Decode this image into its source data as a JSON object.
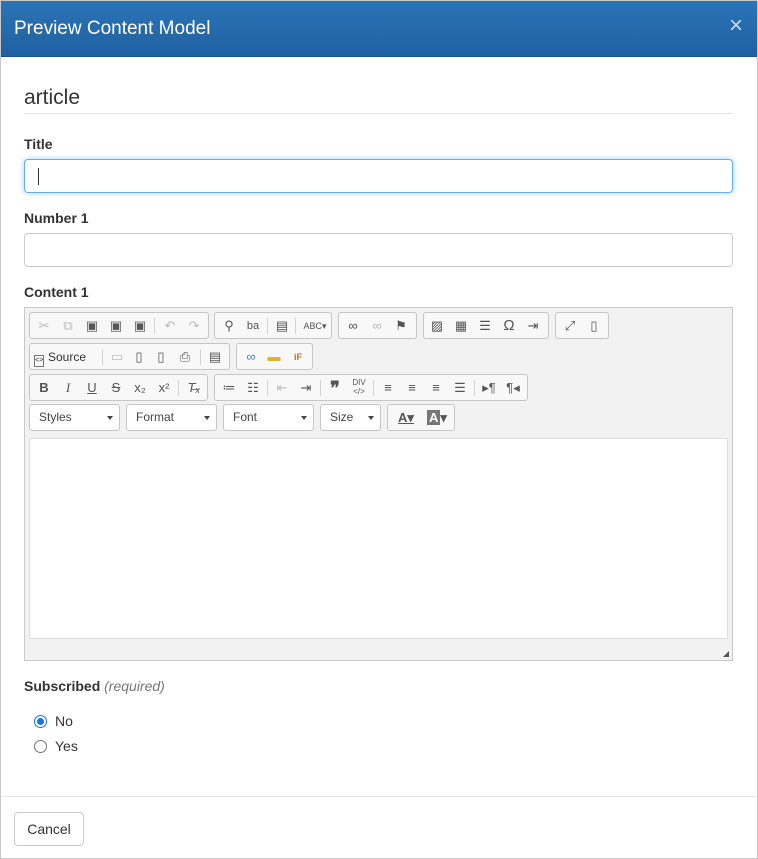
{
  "modal": {
    "title": "Preview Content Model",
    "close": "×"
  },
  "form": {
    "heading": "article",
    "title_label": "Title",
    "title_value": "",
    "number_label": "Number 1",
    "number_value": "",
    "content_label": "Content 1"
  },
  "editor": {
    "row1": [
      {
        "icon": "cut-icon",
        "glyph": "✂",
        "disabled": true
      },
      {
        "icon": "copy-icon",
        "glyph": "⧉",
        "disabled": true
      },
      {
        "icon": "paste-icon",
        "glyph": "📋",
        "disabled": false
      },
      {
        "icon": "paste-text-icon",
        "glyph": "📋",
        "disabled": false
      },
      {
        "icon": "paste-word-icon",
        "glyph": "📋",
        "disabled": false
      },
      {
        "icon": "undo-icon",
        "glyph": "↶",
        "disabled": true
      },
      {
        "icon": "redo-icon",
        "glyph": "↷",
        "disabled": true
      },
      {
        "icon": "find-icon",
        "glyph": "🔍",
        "disabled": false
      },
      {
        "icon": "replace-icon",
        "glyph": "ba",
        "disabled": false
      },
      {
        "icon": "select-all-icon",
        "glyph": "▤",
        "disabled": false
      },
      {
        "icon": "spellcheck-icon",
        "glyph": "ABC",
        "disabled": false
      },
      {
        "icon": "link-icon",
        "glyph": "🔗",
        "disabled": false
      },
      {
        "icon": "unlink-icon",
        "glyph": "⛓",
        "disabled": true
      },
      {
        "icon": "anchor-icon",
        "glyph": "⚑",
        "disabled": false
      },
      {
        "icon": "image-icon",
        "glyph": "🖼",
        "disabled": false
      },
      {
        "icon": "table-icon",
        "glyph": "▦",
        "disabled": false
      },
      {
        "icon": "horizontal-rule-icon",
        "glyph": "☰",
        "disabled": false
      },
      {
        "icon": "special-char-icon",
        "glyph": "Ω",
        "disabled": false
      },
      {
        "icon": "page-break-icon",
        "glyph": "⇥",
        "disabled": false
      },
      {
        "icon": "maximize-icon",
        "glyph": "⤢",
        "disabled": false
      },
      {
        "icon": "show-blocks-icon",
        "glyph": "▯",
        "disabled": false
      }
    ],
    "source_label": "Source",
    "styles_label": "Styles",
    "format_label": "Format",
    "font_label": "Font",
    "size_label": "Size",
    "text_color_glyph": "A",
    "bg_color_glyph": "A"
  },
  "subscribed": {
    "label": "Subscribed",
    "required": "(required)",
    "options": [
      "No",
      "Yes"
    ],
    "selected": "No"
  },
  "footer": {
    "cancel": "Cancel"
  }
}
